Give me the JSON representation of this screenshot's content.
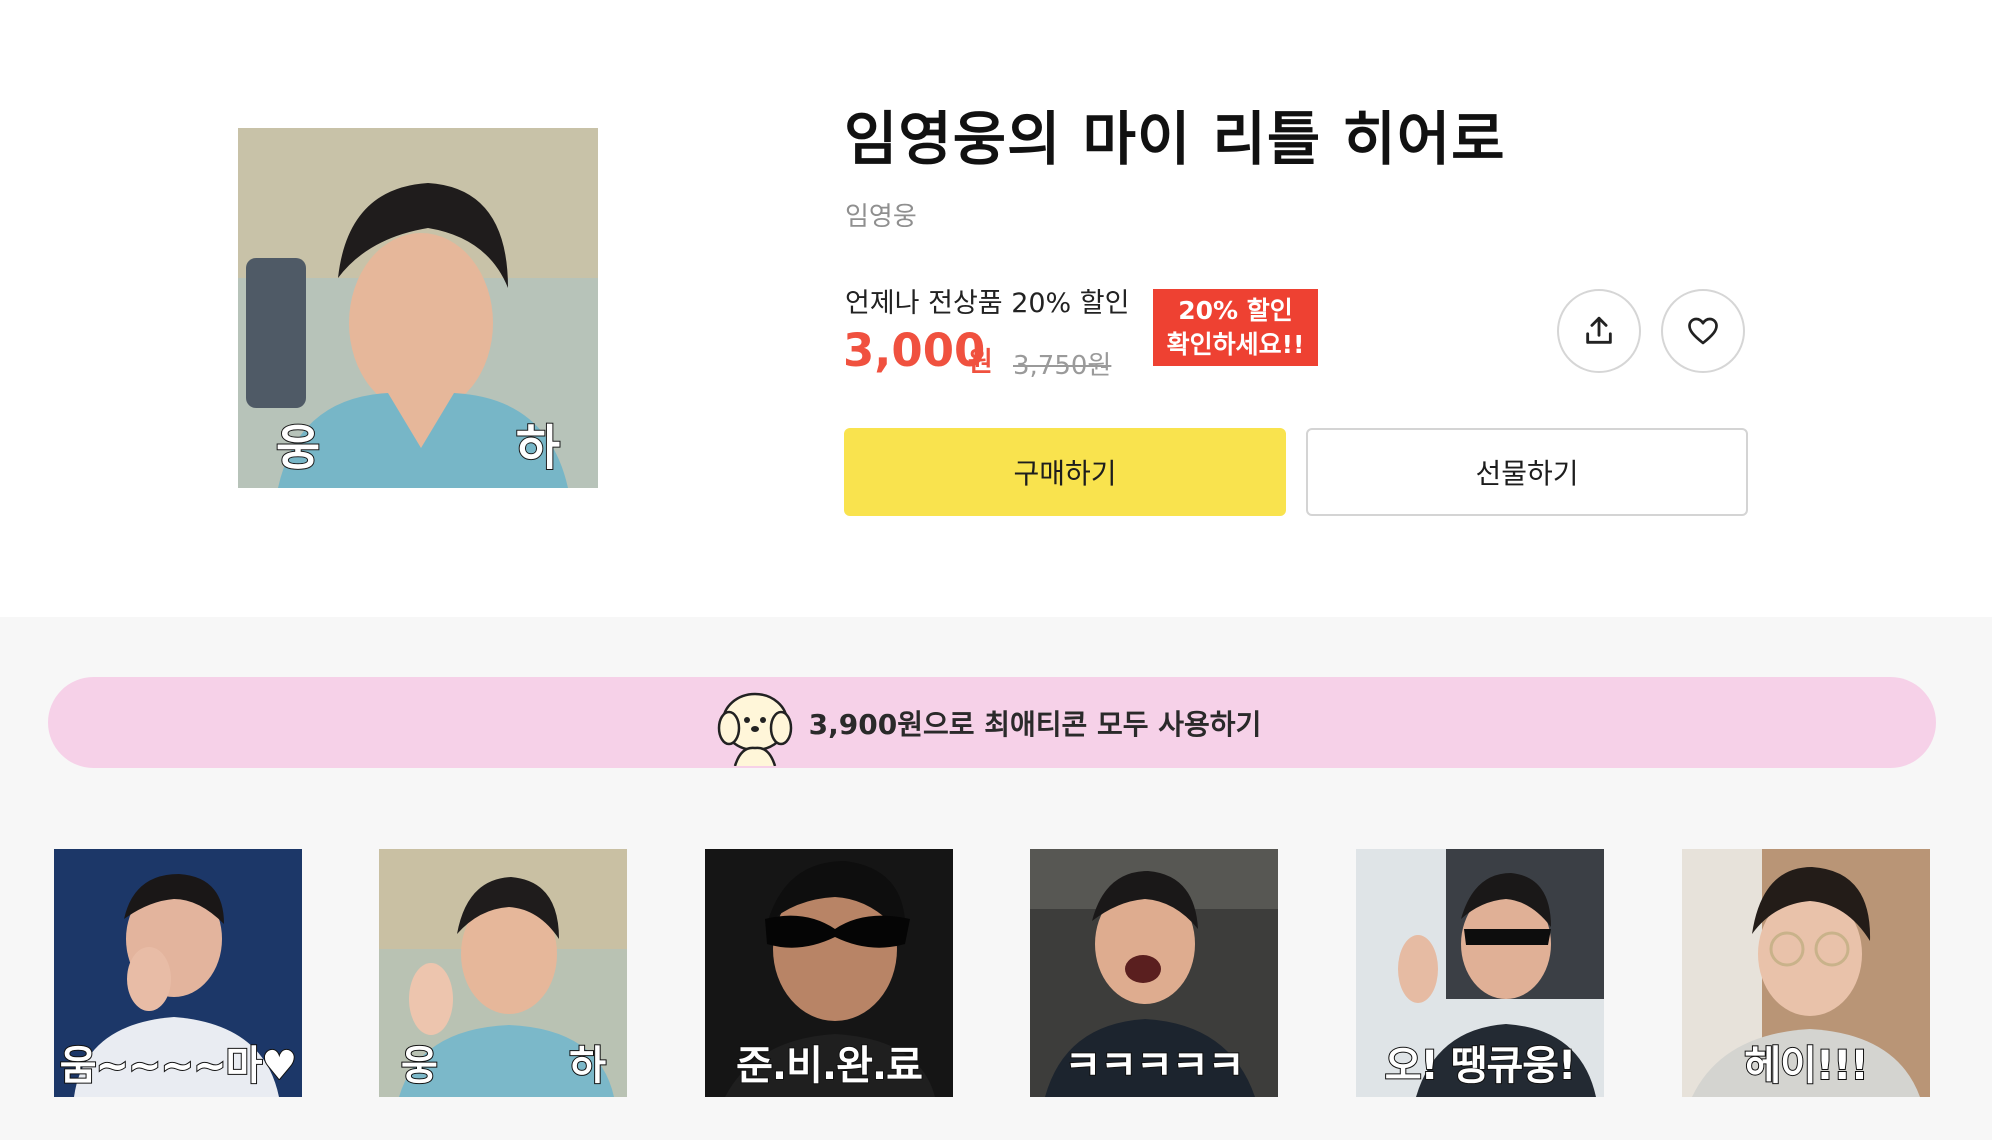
{
  "product": {
    "title": "임영웅의 마이 리틀 히어로",
    "author": "임영웅",
    "thumbnail_caption_left": "웅",
    "thumbnail_caption_right": "하"
  },
  "pricing": {
    "promo_text": "언제나 전상품 20% 할인",
    "price": "3,000",
    "price_unit": "원",
    "original_price": "3,750원",
    "badge_line1": "20% 할인",
    "badge_line2": "확인하세요!!",
    "accent_color": "#f0513f",
    "badge_color": "#ee4132"
  },
  "actions": {
    "share_icon": "share-upload-icon",
    "like_icon": "heart-outline-icon",
    "buy_label": "구매하기",
    "gift_label": "선물하기",
    "buy_color": "#f9e34e"
  },
  "banner": {
    "text": "3,900원으로 최애티콘 모두 사용하기",
    "mascot_icon": "puppy-mascot-icon",
    "color": "#f6d1e8"
  },
  "emoticons": [
    {
      "caption": "움~~~~마♥"
    },
    {
      "caption_left": "웅",
      "caption_right": "하"
    },
    {
      "caption": "준.비.완.료"
    },
    {
      "caption": "ㅋㅋㅋㅋㅋ"
    },
    {
      "caption": "오! 땡큐웅!"
    },
    {
      "caption": "헤이!!!"
    }
  ]
}
